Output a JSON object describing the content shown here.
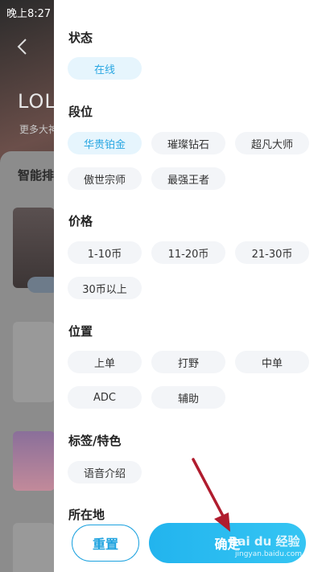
{
  "status_bar": {
    "time": "晚上8:27"
  },
  "background": {
    "title": "LOL",
    "subtitle": "更多大神",
    "section_title": "智能排"
  },
  "filter": {
    "sections": {
      "status": {
        "title": "状态",
        "options": [
          "在线"
        ],
        "selected": "在线"
      },
      "rank": {
        "title": "段位",
        "options": [
          "华贵铂金",
          "璀璨钻石",
          "超凡大师",
          "傲世宗师",
          "最强王者"
        ],
        "selected": "华贵铂金"
      },
      "price": {
        "title": "价格",
        "options": [
          "1-10币",
          "11-20币",
          "21-30币",
          "30币以上"
        ]
      },
      "position": {
        "title": "位置",
        "options": [
          "上单",
          "打野",
          "中单",
          "ADC",
          "辅助"
        ]
      },
      "tags": {
        "title": "标签/特色",
        "options": [
          "语音介绍"
        ]
      },
      "location": {
        "title": "所在地"
      }
    },
    "buttons": {
      "reset": "重置",
      "confirm": "确定"
    }
  },
  "watermark": {
    "text": "Bai du 经验",
    "url": "jingyan.baidu.com"
  },
  "colors": {
    "accent": "#1da2df",
    "chip_bg": "#f3f5f8",
    "selected_chip_bg": "#e6f5fd",
    "arrow": "#b01c2e"
  }
}
